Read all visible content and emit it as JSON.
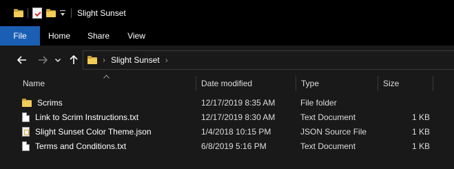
{
  "window": {
    "title": "Slight Sunset"
  },
  "quick_access": {
    "icons": [
      "folder-icon",
      "properties-icon",
      "new-folder-icon",
      "customize-dropdown-icon"
    ]
  },
  "ribbon": {
    "tabs": [
      {
        "label": "File"
      },
      {
        "label": "Home"
      },
      {
        "label": "Share"
      },
      {
        "label": "View"
      }
    ]
  },
  "navigation": {
    "breadcrumb": [
      "Slight Sunset"
    ]
  },
  "columns": [
    {
      "label": "Name"
    },
    {
      "label": "Date modified"
    },
    {
      "label": "Type"
    },
    {
      "label": "Size"
    }
  ],
  "files": [
    {
      "icon": "folder-icon",
      "name": "Scrims",
      "date": "12/17/2019 8:35 AM",
      "type": "File folder",
      "size": ""
    },
    {
      "icon": "text-file-icon",
      "name": "Link to Scrim Instructions.txt",
      "date": "12/17/2019 8:30 AM",
      "type": "Text Document",
      "size": "1 KB"
    },
    {
      "icon": "json-file-icon",
      "name": "Slight Sunset Color Theme.json",
      "date": "1/4/2018 10:15 PM",
      "type": "JSON Source File",
      "size": "1 KB"
    },
    {
      "icon": "text-file-icon",
      "name": "Terms and Conditions.txt",
      "date": "6/8/2019 5:16 PM",
      "type": "Text Document",
      "size": "1 KB"
    }
  ],
  "colors": {
    "titlebar_bg": "#000000",
    "content_bg": "#191919",
    "file_tab_accent": "#1a5fb4",
    "folder_yellow": "#f2cd5a"
  }
}
